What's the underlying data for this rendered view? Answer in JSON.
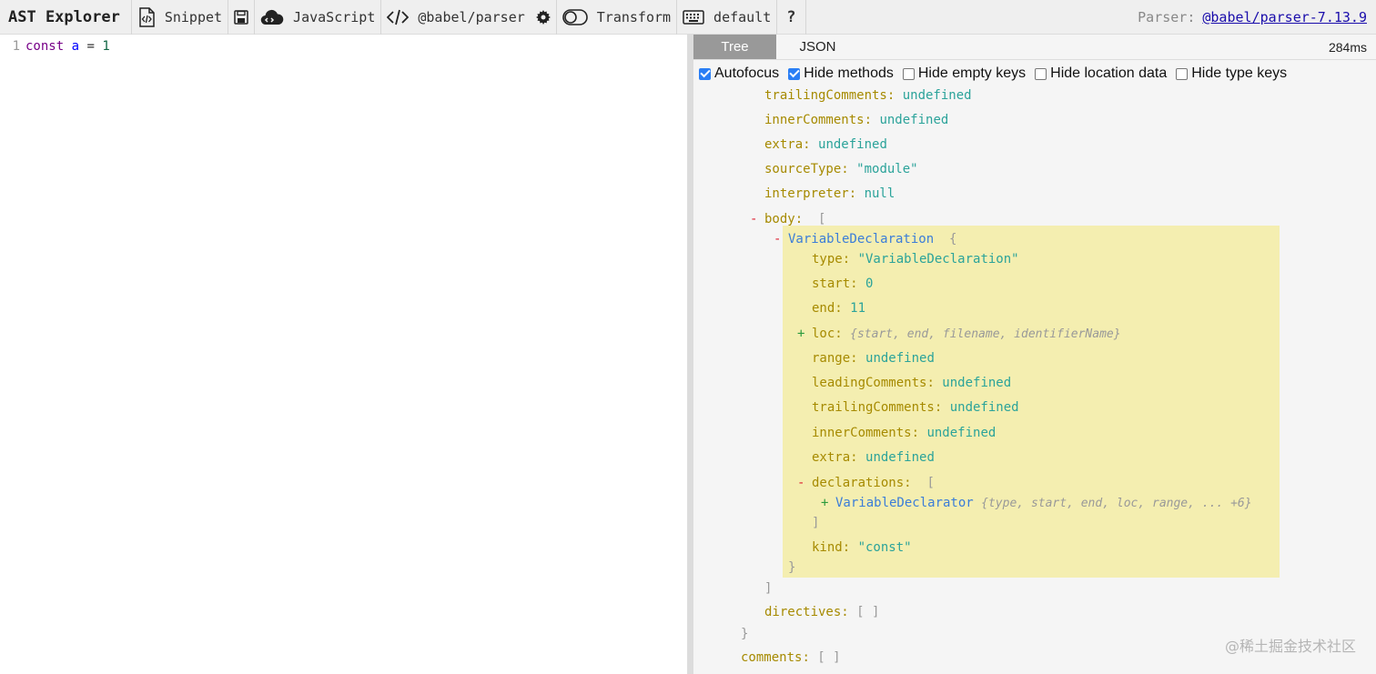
{
  "app": {
    "title": "AST Explorer"
  },
  "toolbar": {
    "snippet": "Snippet",
    "language": "JavaScript",
    "parser": "@babel/parser",
    "transform": "Transform",
    "keymap": "default",
    "help": "?",
    "parser_info_label": "Parser:",
    "parser_info_link": "@babel/parser-7.13.9"
  },
  "editor": {
    "line_number": "1",
    "code": {
      "kw": "const",
      "name": "a",
      "op": "=",
      "value": "1"
    }
  },
  "output": {
    "tabs": [
      "Tree",
      "JSON"
    ],
    "active_tab": "Tree",
    "build_time": "284ms",
    "options": [
      {
        "label": "Autofocus",
        "checked": true
      },
      {
        "label": "Hide methods",
        "checked": true
      },
      {
        "label": "Hide empty keys",
        "checked": false
      },
      {
        "label": "Hide location data",
        "checked": false
      },
      {
        "label": "Hide type keys",
        "checked": false
      }
    ]
  },
  "tree": {
    "program": {
      "trailingComments": {
        "key": "trailingComments",
        "value": "undefined"
      },
      "innerComments": {
        "key": "innerComments",
        "value": "undefined"
      },
      "extra": {
        "key": "extra",
        "value": "undefined"
      },
      "sourceType": {
        "key": "sourceType",
        "value": "\"module\""
      },
      "interpreter": {
        "key": "interpreter",
        "value": "null"
      },
      "body": {
        "key": "body",
        "open": "[",
        "close": "]"
      },
      "directives": {
        "key": "directives",
        "value": "[ ]"
      }
    },
    "decl": {
      "name": "VariableDeclaration",
      "open": "{",
      "close": "}",
      "type": {
        "key": "type",
        "value": "\"VariableDeclaration\""
      },
      "start": {
        "key": "start",
        "value": "0"
      },
      "end": {
        "key": "end",
        "value": "11"
      },
      "loc": {
        "key": "loc",
        "summary": "{start, end, filename, identifierName}"
      },
      "range": {
        "key": "range",
        "value": "undefined"
      },
      "leadingComments": {
        "key": "leadingComments",
        "value": "undefined"
      },
      "trailingComments": {
        "key": "trailingComments",
        "value": "undefined"
      },
      "innerComments": {
        "key": "innerComments",
        "value": "undefined"
      },
      "extra": {
        "key": "extra",
        "value": "undefined"
      },
      "declarations": {
        "key": "declarations",
        "open": "[",
        "close": "]"
      },
      "declarator": {
        "name": "VariableDeclarator",
        "summary": "{type, start, end, loc, range, ... +6}"
      },
      "kind": {
        "key": "kind",
        "value": "\"const\""
      }
    },
    "file_close": "}",
    "comments": {
      "key": "comments",
      "value": "[ ]"
    }
  },
  "watermark": "@稀土掘金技术社区"
}
